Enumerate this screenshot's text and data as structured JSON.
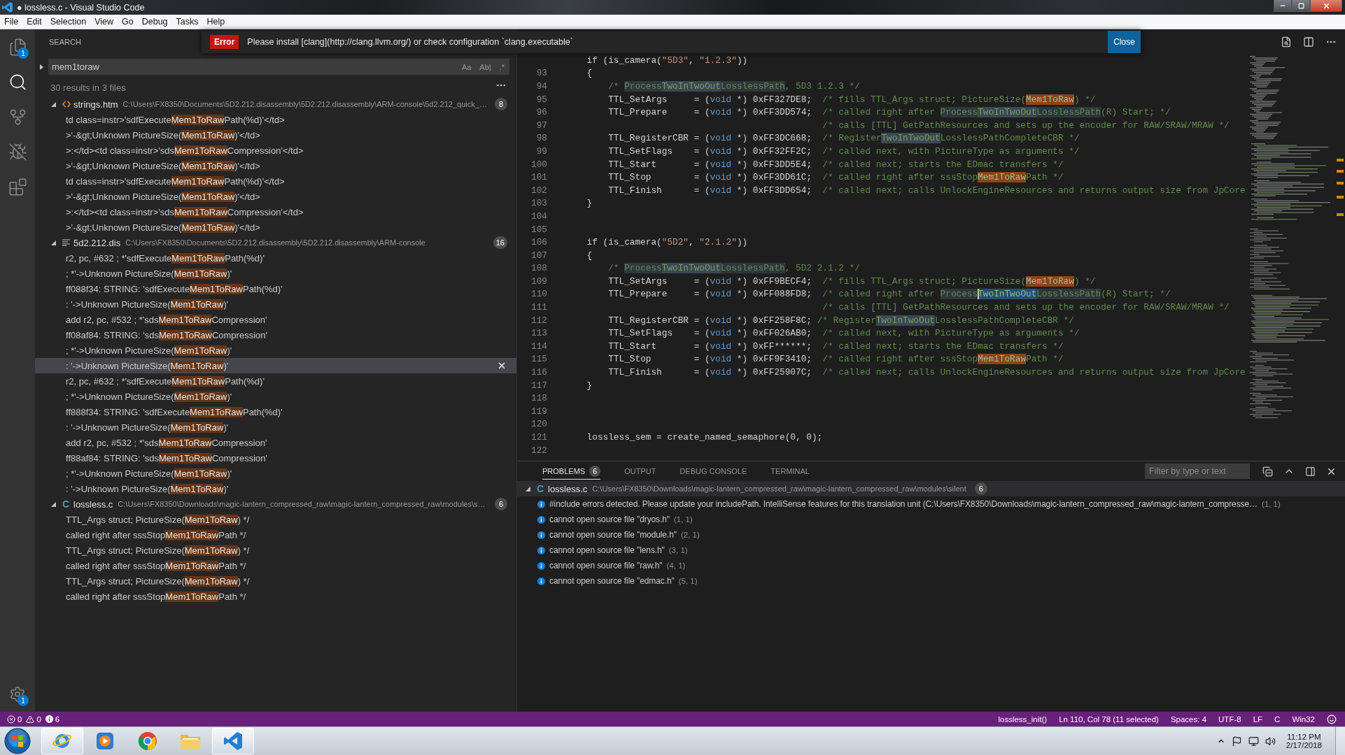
{
  "window": {
    "title": "● lossless.c - Visual Studio Code"
  },
  "menu": [
    "File",
    "Edit",
    "Selection",
    "View",
    "Go",
    "Debug",
    "Tasks",
    "Help"
  ],
  "activity_bar": {
    "items": [
      {
        "kind": "explorer",
        "selected": false,
        "badge": "1"
      },
      {
        "kind": "search",
        "selected": true
      },
      {
        "kind": "source_control",
        "selected": false
      },
      {
        "kind": "debug",
        "selected": false
      },
      {
        "kind": "extensions",
        "selected": false
      }
    ],
    "settings_badge": "1"
  },
  "notification": {
    "badge": "Error",
    "message": "Please install [clang](http://clang.llvm.org/) or check configuration `clang.executable`",
    "button": "Close"
  },
  "search": {
    "title": "SEARCH",
    "replace_expanded": false,
    "query": "mem1toraw",
    "toggles": [
      {
        "label": "Aa",
        "on": false
      },
      {
        "label": "Ab|",
        "on": false
      },
      {
        "label": ".*",
        "on": false
      }
    ],
    "summary": "30 results in 3 files",
    "groups": [
      {
        "kind": "html",
        "name": "strings.htm",
        "path": "C:\\Users\\FX8350\\Documents\\5D2.212.disassembly\\5D2.212.disassembly\\ARM-console\\5d2.212_quick_…",
        "count": "8",
        "expanded": true,
        "matches": [
          {
            "before": "td class=instr>'sdfExecute",
            "match": "Mem1ToRaw",
            "after": "Path(%d)'</td>",
            "selected": false
          },
          {
            "before": ">'-&gt;Unknown PictureSize(",
            "match": "Mem1ToRaw",
            "after": ")'</td>",
            "selected": false
          },
          {
            "before": ">:</td><td class=instr>'sds",
            "match": "Mem1ToRaw",
            "after": "Compression'</td>",
            "selected": false
          },
          {
            "before": ">'-&gt;Unknown PictureSize(",
            "match": "Mem1ToRaw",
            "after": ")'</td>",
            "selected": false
          },
          {
            "before": "td class=instr>'sdfExecute",
            "match": "Mem1ToRaw",
            "after": "Path(%d)'</td>",
            "selected": false
          },
          {
            "before": ">'-&gt;Unknown PictureSize(",
            "match": "Mem1ToRaw",
            "after": ")'</td>",
            "selected": false
          },
          {
            "before": ">:</td><td class=instr>'sds",
            "match": "Mem1ToRaw",
            "after": "Compression'</td>",
            "selected": false
          },
          {
            "before": ">'-&gt;Unknown PictureSize(",
            "match": "Mem1ToRaw",
            "after": ")'</td>",
            "selected": false
          }
        ]
      },
      {
        "kind": "text",
        "name": "5d2.212.dis",
        "path": "C:\\Users\\FX8350\\Documents\\5D2.212.disassembly\\5D2.212.disassembly\\ARM-console",
        "count": "16",
        "expanded": true,
        "matches": [
          {
            "before": "r2, pc, #632 ; *'sdfExecute",
            "match": "Mem1ToRaw",
            "after": "Path(%d)'",
            "selected": false
          },
          {
            "before": "; *'->Unknown PictureSize(",
            "match": "Mem1ToRaw",
            "after": ")'",
            "selected": false
          },
          {
            "before": "ff088f34: STRING: 'sdfExecute",
            "match": "Mem1ToRaw",
            "after": "Path(%d)'",
            "selected": false
          },
          {
            "before": ": '->Unknown PictureSize(",
            "match": "Mem1ToRaw",
            "after": ")'",
            "selected": false
          },
          {
            "before": "add r2, pc, #532 ; *'sds",
            "match": "Mem1ToRaw",
            "after": "Compression'",
            "selected": false
          },
          {
            "before": "ff08af84: STRING: 'sds",
            "match": "Mem1ToRaw",
            "after": "Compression'",
            "selected": false
          },
          {
            "before": "; *'->Unknown PictureSize(",
            "match": "Mem1ToRaw",
            "after": ")'",
            "selected": false
          },
          {
            "before": ": '->Unknown PictureSize(",
            "match": "Mem1ToRaw",
            "after": ")'",
            "selected": true
          },
          {
            "before": "r2, pc, #632 ; *'sdfExecute",
            "match": "Mem1ToRaw",
            "after": "Path(%d)'",
            "selected": false
          },
          {
            "before": "; *'->Unknown PictureSize(",
            "match": "Mem1ToRaw",
            "after": ")'",
            "selected": false
          },
          {
            "before": "ff888f34: STRING: 'sdfExecute",
            "match": "Mem1ToRaw",
            "after": "Path(%d)'",
            "selected": false
          },
          {
            "before": ": '->Unknown PictureSize(",
            "match": "Mem1ToRaw",
            "after": ")'",
            "selected": false
          },
          {
            "before": "add r2, pc, #532 ; *'sds",
            "match": "Mem1ToRaw",
            "after": "Compression'",
            "selected": false
          },
          {
            "before": "ff88af84: STRING: 'sds",
            "match": "Mem1ToRaw",
            "after": "Compression'",
            "selected": false
          },
          {
            "before": "; *'->Unknown PictureSize(",
            "match": "Mem1ToRaw",
            "after": ")'",
            "selected": false
          },
          {
            "before": ": '->Unknown PictureSize(",
            "match": "Mem1ToRaw",
            "after": ")'",
            "selected": false
          }
        ]
      },
      {
        "kind": "c",
        "icon_label": "C",
        "name": "lossless.c",
        "path": "C:\\Users\\FX8350\\Downloads\\magic-lantern_compressed_raw\\magic-lantern_compressed_raw\\modules\\s…",
        "count": "6",
        "expanded": true,
        "matches": [
          {
            "before": "TTL_Args struct; PictureSize(",
            "match": "Mem1ToRaw",
            "after": ") */",
            "selected": false
          },
          {
            "before": "called right after sssStop",
            "match": "Mem1ToRaw",
            "after": "Path */",
            "selected": false
          },
          {
            "before": "TTL_Args struct; PictureSize(",
            "match": "Mem1ToRaw",
            "after": ") */",
            "selected": false
          },
          {
            "before": "called right after sssStop",
            "match": "Mem1ToRaw",
            "after": "Path */",
            "selected": false
          },
          {
            "before": "TTL_Args struct; PictureSize(",
            "match": "Mem1ToRaw",
            "after": ") */",
            "selected": false
          },
          {
            "before": "called right after sssStop",
            "match": "Mem1ToRaw",
            "after": "Path */",
            "selected": false
          }
        ]
      }
    ]
  },
  "editor": {
    "lines": [
      {
        "tokens": [
          {
            "text": "    if (is_camera(",
            "kind": "plain"
          },
          {
            "text": "\"5D3\"",
            "kind": "string"
          },
          {
            "text": ", ",
            "kind": "plain"
          },
          {
            "text": "\"1.2.3\"",
            "kind": "string"
          },
          {
            "text": "))",
            "kind": "plain"
          }
        ]
      },
      {
        "number": "93",
        "tokens": [
          {
            "text": "    {",
            "kind": "plain"
          }
        ]
      },
      {
        "number": "94",
        "tokens": [
          {
            "text": "        /* ",
            "kind": "comment"
          },
          {
            "text": "Process",
            "kind": "word_highlight"
          },
          {
            "text": "TwoInTwoOut",
            "kind": "selection_match"
          },
          {
            "text": "LosslessPath",
            "kind": "word_highlight"
          },
          {
            "text": ", 5D3 1.2.3 */",
            "kind": "comment"
          }
        ]
      },
      {
        "number": "95",
        "tokens": [
          {
            "text": "        TTL_SetArgs     = (",
            "kind": "plain"
          },
          {
            "text": "void",
            "kind": "keyword"
          },
          {
            "text": " *) 0xFF327DE8;  ",
            "kind": "plain"
          },
          {
            "text": "/* fills TTL_Args struct; PictureSize(",
            "kind": "comment"
          },
          {
            "text": "Mem1ToRaw",
            "kind": "find_match"
          },
          {
            "text": ") */",
            "kind": "comment"
          }
        ]
      },
      {
        "number": "96",
        "tokens": [
          {
            "text": "        TTL_Prepare     = (",
            "kind": "plain"
          },
          {
            "text": "void",
            "kind": "keyword"
          },
          {
            "text": " *) 0xFF3DD574;  ",
            "kind": "plain"
          },
          {
            "text": "/* called right after ",
            "kind": "comment"
          },
          {
            "text": "Process",
            "kind": "word_highlight"
          },
          {
            "text": "TwoInTwoOut",
            "kind": "selection_match"
          },
          {
            "text": "LosslessPath",
            "kind": "word_highlight"
          },
          {
            "text": "(R) Start; */",
            "kind": "comment"
          }
        ]
      },
      {
        "number": "97",
        "tokens": [
          {
            "text": "                                                /* calls [TTL] GetPathResources and sets up the encoder for RAW/SRAW/MRAW */",
            "kind": "comment"
          }
        ]
      },
      {
        "number": "98",
        "tokens": [
          {
            "text": "        TTL_RegisterCBR = (",
            "kind": "plain"
          },
          {
            "text": "void",
            "kind": "keyword"
          },
          {
            "text": " *) 0xFF3DC668;  ",
            "kind": "plain"
          },
          {
            "text": "/* Register",
            "kind": "comment"
          },
          {
            "text": "TwoInTwoOut",
            "kind": "selection_match"
          },
          {
            "text": "LosslessPathCompleteCBR */",
            "kind": "comment"
          }
        ]
      },
      {
        "number": "99",
        "tokens": [
          {
            "text": "        TTL_SetFlags    = (",
            "kind": "plain"
          },
          {
            "text": "void",
            "kind": "keyword"
          },
          {
            "text": " *) 0xFF32FF2C;  ",
            "kind": "plain"
          },
          {
            "text": "/* called next, with PictureType as arguments */",
            "kind": "comment"
          }
        ]
      },
      {
        "number": "100",
        "tokens": [
          {
            "text": "        TTL_Start       = (",
            "kind": "plain"
          },
          {
            "text": "void",
            "kind": "keyword"
          },
          {
            "text": " *) 0xFF3DD5E4;  ",
            "kind": "plain"
          },
          {
            "text": "/* called next; starts the EDmac transfers */",
            "kind": "comment"
          }
        ]
      },
      {
        "number": "101",
        "tokens": [
          {
            "text": "        TTL_Stop        = (",
            "kind": "plain"
          },
          {
            "text": "void",
            "kind": "keyword"
          },
          {
            "text": " *) 0xFF3DD61C;  ",
            "kind": "plain"
          },
          {
            "text": "/* called right after sssStop",
            "kind": "comment"
          },
          {
            "text": "Mem1ToRaw",
            "kind": "find_match"
          },
          {
            "text": "Path */",
            "kind": "comment"
          }
        ]
      },
      {
        "number": "102",
        "tokens": [
          {
            "text": "        TTL_Finish      = (",
            "kind": "plain"
          },
          {
            "text": "void",
            "kind": "keyword"
          },
          {
            "text": " *) 0xFF3DD654;  ",
            "kind": "plain"
          },
          {
            "text": "/* called next; calls UnlockEngineResources and returns output size from JpCore",
            "kind": "comment"
          }
        ]
      },
      {
        "number": "103",
        "tokens": [
          {
            "text": "    }",
            "kind": "plain"
          }
        ]
      },
      {
        "number": "104"
      },
      {
        "number": "105"
      },
      {
        "number": "106",
        "tokens": [
          {
            "text": "    if (is_camera(",
            "kind": "plain"
          },
          {
            "text": "\"5D2\"",
            "kind": "string"
          },
          {
            "text": ", ",
            "kind": "plain"
          },
          {
            "text": "\"2.1.2\"",
            "kind": "string"
          },
          {
            "text": "))",
            "kind": "plain"
          }
        ]
      },
      {
        "number": "107",
        "tokens": [
          {
            "text": "    {",
            "kind": "plain"
          }
        ]
      },
      {
        "number": "108",
        "tokens": [
          {
            "text": "        /* ",
            "kind": "comment"
          },
          {
            "text": "Process",
            "kind": "word_highlight"
          },
          {
            "text": "TwoInTwoOut",
            "kind": "selection_match"
          },
          {
            "text": "LosslessPath",
            "kind": "word_highlight"
          },
          {
            "text": ", 5D2 2.1.2 */",
            "kind": "comment"
          }
        ]
      },
      {
        "number": "109",
        "tokens": [
          {
            "text": "        TTL_SetArgs     = (",
            "kind": "plain"
          },
          {
            "text": "void",
            "kind": "keyword"
          },
          {
            "text": " *) 0xFF9BECF4;  ",
            "kind": "plain"
          },
          {
            "text": "/* fills TTL_Args struct; PictureSize(",
            "kind": "comment"
          },
          {
            "text": "Mem1ToRaw",
            "kind": "find_match"
          },
          {
            "text": ") */",
            "kind": "comment"
          }
        ]
      },
      {
        "number": "110",
        "tokens": [
          {
            "text": "        TTL_Prepare     = (",
            "kind": "plain"
          },
          {
            "text": "void",
            "kind": "keyword"
          },
          {
            "text": " *) 0xFF088FD8;  ",
            "kind": "plain"
          },
          {
            "text": "/* called right after ",
            "kind": "comment"
          },
          {
            "text": "Process",
            "kind": "word_highlight"
          },
          {
            "text": "TwoInTwoOut",
            "kind": "selection"
          },
          {
            "text": "LosslessPath",
            "kind": "word_highlight"
          },
          {
            "text": "(R) Start; */",
            "kind": "comment"
          }
        ]
      },
      {
        "number": "111",
        "tokens": [
          {
            "text": "                                                /* calls [TTL] GetPathResources and sets up the encoder for RAW/SRAW/MRAW */",
            "kind": "comment"
          }
        ]
      },
      {
        "number": "112",
        "tokens": [
          {
            "text": "        TTL_RegisterCBR = (",
            "kind": "plain"
          },
          {
            "text": "void",
            "kind": "keyword"
          },
          {
            "text": " *) 0xFF258F8C; ",
            "kind": "plain"
          },
          {
            "text": "/* Register",
            "kind": "comment"
          },
          {
            "text": "TwoInTwoOut",
            "kind": "selection_match"
          },
          {
            "text": "LosslessPathCompleteCBR */",
            "kind": "comment"
          }
        ]
      },
      {
        "number": "113",
        "tokens": [
          {
            "text": "        TTL_SetFlags    = (",
            "kind": "plain"
          },
          {
            "text": "void",
            "kind": "keyword"
          },
          {
            "text": " *) 0xFF026AB0;  ",
            "kind": "plain"
          },
          {
            "text": "/* called next, with PictureType as arguments */",
            "kind": "comment"
          }
        ]
      },
      {
        "number": "114",
        "tokens": [
          {
            "text": "        TTL_Start       = (",
            "kind": "plain"
          },
          {
            "text": "void",
            "kind": "keyword"
          },
          {
            "text": " *) 0xFF******;  ",
            "kind": "plain"
          },
          {
            "text": "/* called next; starts the EDmac transfers */",
            "kind": "comment"
          }
        ]
      },
      {
        "number": "115",
        "tokens": [
          {
            "text": "        TTL_Stop        = (",
            "kind": "plain"
          },
          {
            "text": "void",
            "kind": "keyword"
          },
          {
            "text": " *) 0xFF9F3410;  ",
            "kind": "plain"
          },
          {
            "text": "/* called right after sssStop",
            "kind": "comment"
          },
          {
            "text": "Mem1ToRaw",
            "kind": "find_match"
          },
          {
            "text": "Path */",
            "kind": "comment"
          }
        ]
      },
      {
        "number": "116",
        "tokens": [
          {
            "text": "        TTL_Finish      = (",
            "kind": "plain"
          },
          {
            "text": "void",
            "kind": "keyword"
          },
          {
            "text": " *) 0xFF25907C;  ",
            "kind": "plain"
          },
          {
            "text": "/* called next; calls UnlockEngineResources and returns output size from JpCore",
            "kind": "comment"
          }
        ]
      },
      {
        "number": "117",
        "tokens": [
          {
            "text": "    }",
            "kind": "plain"
          }
        ]
      },
      {
        "number": "118"
      },
      {
        "number": "119"
      },
      {
        "number": "120"
      },
      {
        "number": "121",
        "tokens": [
          {
            "text": "    lossless_sem = create_named_semaphore(0, 0);",
            "kind": "plain"
          }
        ]
      },
      {
        "number": "122"
      }
    ]
  },
  "panel": {
    "tabs": [
      {
        "label": "PROBLEMS",
        "badge": "6",
        "selected": true
      },
      {
        "label": "OUTPUT",
        "selected": false
      },
      {
        "label": "DEBUG CONSOLE",
        "selected": false
      },
      {
        "label": "TERMINAL",
        "selected": false
      }
    ],
    "filter_placeholder": "Filter by type or text",
    "file": {
      "kind": "c",
      "icon_label": "C",
      "name": "lossless.c",
      "path": "C:\\Users\\FX8350\\Downloads\\magic-lantern_compressed_raw\\magic-lantern_compressed_raw\\modules\\silent",
      "count": "6",
      "expanded": true,
      "selected": true
    },
    "problems": [
      {
        "kind": "info",
        "message": "#include errors detected. Please update your includePath. IntelliSense features for this translation unit (C:\\Users\\FX8350\\Downloads\\magic-lantern_compressed_raw\\magic-lantern_compresse…",
        "location": "(1, 1)"
      },
      {
        "kind": "info",
        "message": "cannot open source file \"dryos.h\"",
        "location": "(1, 1)"
      },
      {
        "kind": "info",
        "message": "cannot open source file \"module.h\"",
        "location": "(2, 1)"
      },
      {
        "kind": "info",
        "message": "cannot open source file \"lens.h\"",
        "location": "(3, 1)"
      },
      {
        "kind": "info",
        "message": "cannot open source file \"raw.h\"",
        "location": "(4, 1)"
      },
      {
        "kind": "info",
        "message": "cannot open source file \"edmac.h\"",
        "location": "(5, 1)"
      }
    ]
  },
  "status_bar": {
    "errors": "0",
    "warnings": "0",
    "infos": "6",
    "items": [
      "lossless_init()",
      "Ln 110, Col 78 (11 selected)",
      "Spaces: 4",
      "UTF-8",
      "LF",
      "C",
      "Win32"
    ]
  },
  "taskbar": {
    "apps": [
      {
        "kind": "ie",
        "running": true
      },
      {
        "kind": "media",
        "running": false
      },
      {
        "kind": "chrome",
        "running": false
      },
      {
        "kind": "files",
        "running": false
      },
      {
        "kind": "editor",
        "running": true
      }
    ],
    "time": "11:12 PM",
    "date": "2/17/2018"
  }
}
